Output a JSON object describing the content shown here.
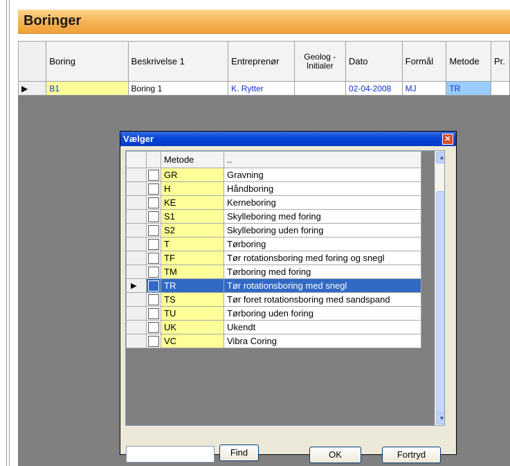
{
  "form": {
    "title": "Boringer"
  },
  "grid": {
    "columns": [
      "Boring",
      "Beskrivelse 1",
      "Entreprenør",
      "Geolog - Initialer",
      "Dato",
      "Formål",
      "Metode",
      "Pr."
    ],
    "rows": [
      {
        "marker": "▶",
        "boring": "B1",
        "beskrivelse": "Boring 1",
        "entreprenor": "K. Rytter",
        "geolog": "",
        "dato": "02-04-2008",
        "formal": "MJ",
        "metode": "TR",
        "pr": ""
      },
      {
        "marker": "✱",
        "boring": "",
        "beskrivelse": "",
        "entreprenor": "",
        "geolog": "",
        "dato": "",
        "formal": "",
        "metode": "",
        "pr": ""
      }
    ]
  },
  "dialog": {
    "title": "Vælger",
    "close_icon": "close-icon",
    "headers": {
      "code": "Metode",
      "desc": ".."
    },
    "items": [
      {
        "code": "GR",
        "desc": "Gravning"
      },
      {
        "code": "H",
        "desc": "Håndboring"
      },
      {
        "code": "KE",
        "desc": "Kerneboring"
      },
      {
        "code": "S1",
        "desc": "Skylleboring med foring"
      },
      {
        "code": "S2",
        "desc": "Skylleboring uden foring"
      },
      {
        "code": "T",
        "desc": "Tørboring"
      },
      {
        "code": "TF",
        "desc": "Tør rotationsboring med foring og snegl"
      },
      {
        "code": "TM",
        "desc": "Tørboring med foring"
      },
      {
        "code": "TR",
        "desc": "Tør rotationsboring med snegl",
        "selected": true,
        "marker": "▶"
      },
      {
        "code": "TS",
        "desc": "Tør foret rotationsboring med sandspand"
      },
      {
        "code": "TU",
        "desc": "Tørboring uden foring"
      },
      {
        "code": "UK",
        "desc": "Ukendt"
      },
      {
        "code": "VC",
        "desc": "Vibra Coring"
      }
    ],
    "search_value": "",
    "find_label": "Find",
    "ok_label": "OK",
    "cancel_label": "Fortryd"
  },
  "colors": {
    "header_orange": "#f5b152",
    "selection_blue": "#316ac5",
    "key_yellow": "#ffff99",
    "link_blue": "#1030d0"
  }
}
